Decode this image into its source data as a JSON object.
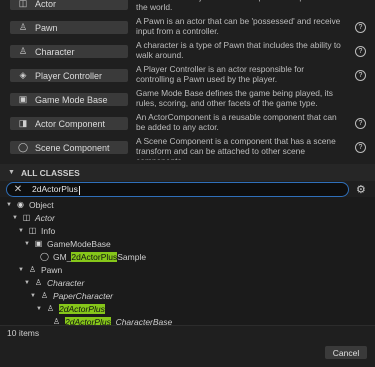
{
  "common_classes": [
    {
      "icon": "actor-icon",
      "label": "Actor",
      "desc": "An Actor is an object that can be placed or spawned in the world."
    },
    {
      "icon": "pawn-icon",
      "label": "Pawn",
      "desc": "A Pawn is an actor that can be 'possessed' and receive input from a controller."
    },
    {
      "icon": "character-icon",
      "label": "Character",
      "desc": "A character is a type of Pawn that includes the ability to walk around."
    },
    {
      "icon": "player-controller-icon",
      "label": "Player Controller",
      "desc": "A Player Controller is an actor responsible for controlling a Pawn used by the player."
    },
    {
      "icon": "game-mode-icon",
      "label": "Game Mode Base",
      "desc": "Game Mode Base defines the game being played, its rules, scoring, and other facets of the game type."
    },
    {
      "icon": "actor-component-icon",
      "label": "Actor Component",
      "desc": "An ActorComponent is a reusable component that can be added to any actor."
    },
    {
      "icon": "scene-component-icon",
      "label": "Scene Component",
      "desc": "A Scene Component is a component that has a scene transform and can be attached to other scene components."
    }
  ],
  "all_classes": {
    "header": "ALL CLASSES",
    "search_value": "2dActorPlus",
    "tree": {
      "object": "Object",
      "actor": "Actor",
      "info": "Info",
      "game_mode_base": "GameModeBase",
      "gm_prefix": "GM_",
      "gm_match": "2dActorPlus",
      "gm_suffix": "Sample",
      "pawn": "Pawn",
      "character": "Character",
      "paper_character": "PaperCharacter",
      "actor_plus": "2dActorPlus",
      "cb_match": "2dActorPlus",
      "cb_suffix": "_CharacterBase"
    }
  },
  "footer": {
    "count": "10 items",
    "cancel": "Cancel"
  }
}
